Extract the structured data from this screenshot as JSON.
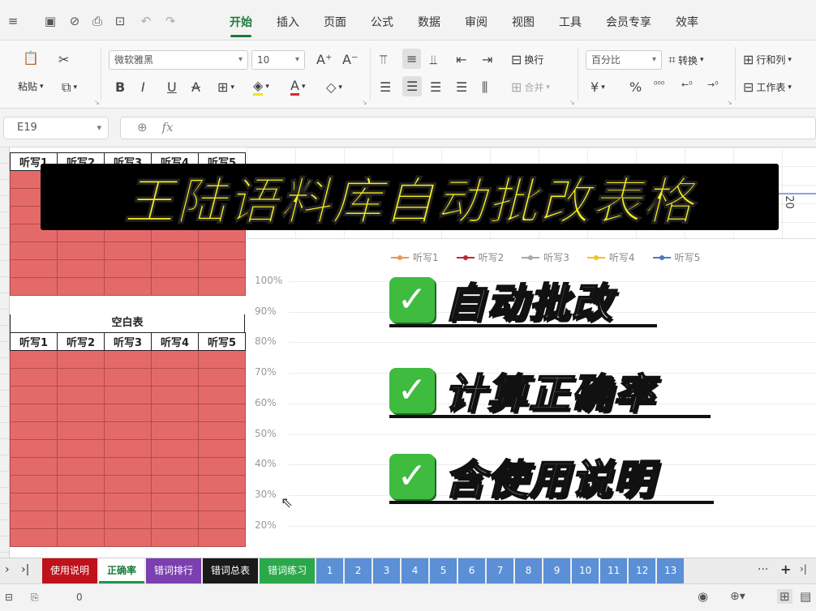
{
  "menu": {
    "tabs": [
      {
        "label": "开始",
        "active": true
      },
      {
        "label": "插入"
      },
      {
        "label": "页面"
      },
      {
        "label": "公式"
      },
      {
        "label": "数据"
      },
      {
        "label": "审阅"
      },
      {
        "label": "视图"
      },
      {
        "label": "工具"
      },
      {
        "label": "会员专享"
      },
      {
        "label": "效率"
      }
    ]
  },
  "ribbon": {
    "paste_label": "粘贴",
    "font_name": "微软雅黑",
    "font_size": "10",
    "wrap_label": "换行",
    "merge_label": "合并",
    "number_format": "百分比",
    "convert_label": "转换",
    "rows_cols_label": "行和列",
    "worksheet_label": "工作表",
    "percent_symbol": "%",
    "currency_symbol": "¥"
  },
  "formula_bar": {
    "cell_ref": "E19",
    "fx_label": "fx"
  },
  "sheet": {
    "columns": [
      "听写1",
      "听写2",
      "听写3",
      "听写4",
      "听写5"
    ],
    "blank_table_label": "空白表",
    "fill_color": "#e46a6a",
    "prev_axis_label": "20"
  },
  "chart_data": {
    "type": "line",
    "title": "",
    "series": [
      {
        "name": "听写1",
        "color": "#f0954a",
        "values": []
      },
      {
        "name": "听写2",
        "color": "#c0282e",
        "values": []
      },
      {
        "name": "听写3",
        "color": "#a8a8a8",
        "values": []
      },
      {
        "name": "听写4",
        "color": "#f5c218",
        "values": []
      },
      {
        "name": "听写5",
        "color": "#4a78c8",
        "values": []
      }
    ],
    "yticks": [
      "100%",
      "90%",
      "80%",
      "70%",
      "60%",
      "50%",
      "40%",
      "30%",
      "20%"
    ],
    "ylim": [
      0.2,
      1.0
    ],
    "legend": "top",
    "grid": true
  },
  "overlay": {
    "title": "王陆语料库自动批改表格",
    "features": [
      "自动批改",
      "计算正确率",
      "含使用说明"
    ],
    "check_mark": "✓",
    "title_color": "#f6ee1e",
    "check_color": "#3fbb3f"
  },
  "sheet_tabs": {
    "named": [
      {
        "label": "使用说明",
        "color": "#c0121a"
      },
      {
        "label": "正确率",
        "color": "#ffffff",
        "active": true
      },
      {
        "label": "错词排行",
        "color": "#7b3fb0"
      },
      {
        "label": "错词总表",
        "color": "#1a1a1a"
      },
      {
        "label": "错词练习",
        "color": "#2aa84a"
      }
    ],
    "numbered": [
      "1",
      "2",
      "3",
      "4",
      "5",
      "6",
      "7",
      "8",
      "9",
      "10",
      "11",
      "12",
      "13"
    ],
    "numbered_color": "#5b8fd6",
    "more_label": "···",
    "add_label": "+"
  },
  "status_bar": {
    "value": "0"
  }
}
